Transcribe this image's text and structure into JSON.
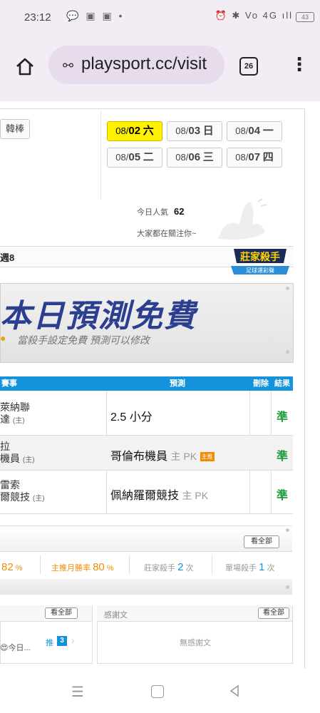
{
  "status_bar": {
    "time": "23:12",
    "battery": "43",
    "left_icons": "💬 ▣ ▣ •",
    "right_icons": "⏰ ✱ Vo 4G ıll"
  },
  "browser": {
    "url": "playsport.cc/visit",
    "tab_count": "26"
  },
  "sidebar_tab": "韓棒",
  "dates": [
    {
      "md": "08/",
      "day": "02",
      "wd": "六",
      "selected": true
    },
    {
      "md": "08/",
      "day": "03",
      "wd": "日",
      "selected": false
    },
    {
      "md": "08/",
      "day": "04",
      "wd": "一",
      "selected": false
    },
    {
      "md": "08/",
      "day": "05",
      "wd": "二",
      "selected": false
    },
    {
      "md": "08/",
      "day": "06",
      "wd": "三",
      "selected": false
    },
    {
      "md": "08/",
      "day": "07",
      "wd": "四",
      "selected": false
    }
  ],
  "popularity": {
    "label": "今日人氣",
    "value": "62"
  },
  "follow_text": "大家都在關注你~",
  "logo": {
    "line1": "莊家殺手",
    "line2": "足球運彩聲"
  },
  "section_title": "週8",
  "banner": {
    "title": "本日預測免費",
    "subtitle": "當殺手設定免費 預測可以修改"
  },
  "table": {
    "headers": {
      "game": "賽事",
      "prediction": "預測",
      "delete": "刪除",
      "result": "結果"
    },
    "rows": [
      {
        "game_line1": "萊納聯",
        "game_line2": "達",
        "home_mark": "(主)",
        "pred_main": "2.5 小分",
        "pred_extra": "",
        "badge": "",
        "result": "準"
      },
      {
        "game_line1": "拉",
        "game_line2": "機員",
        "home_mark": "(主)",
        "pred_main": "哥倫布機員",
        "pred_extra": "主 PK",
        "badge": "主推",
        "result": "準"
      },
      {
        "game_line1": "雷索",
        "game_line2": "爾競技",
        "home_mark": "(主)",
        "pred_main": "佩納羅爾競技",
        "pred_extra": "主 PK",
        "badge": "",
        "result": "準"
      }
    ]
  },
  "stats": {
    "view_all": "看全部",
    "items": [
      {
        "label": "",
        "value": "82",
        "unit": "%"
      },
      {
        "label": "主推月勝率",
        "value": "80",
        "unit": "%"
      },
      {
        "label": "莊家殺手",
        "value": "2",
        "unit": "次"
      },
      {
        "label": "單場殺手",
        "value": "1",
        "unit": "次"
      }
    ]
  },
  "left_card": {
    "view_all": "看全部",
    "snippet": "😍今日...",
    "push_label": "推",
    "push_count": "3"
  },
  "thanks_card": {
    "title": "感謝文",
    "view_all": "看全部",
    "empty": "無感謝文"
  },
  "colors": {
    "accent": "#1592dc",
    "highlight": "#fff200",
    "correct": "#1a9a3a",
    "stat_orange": "#f08c00"
  }
}
